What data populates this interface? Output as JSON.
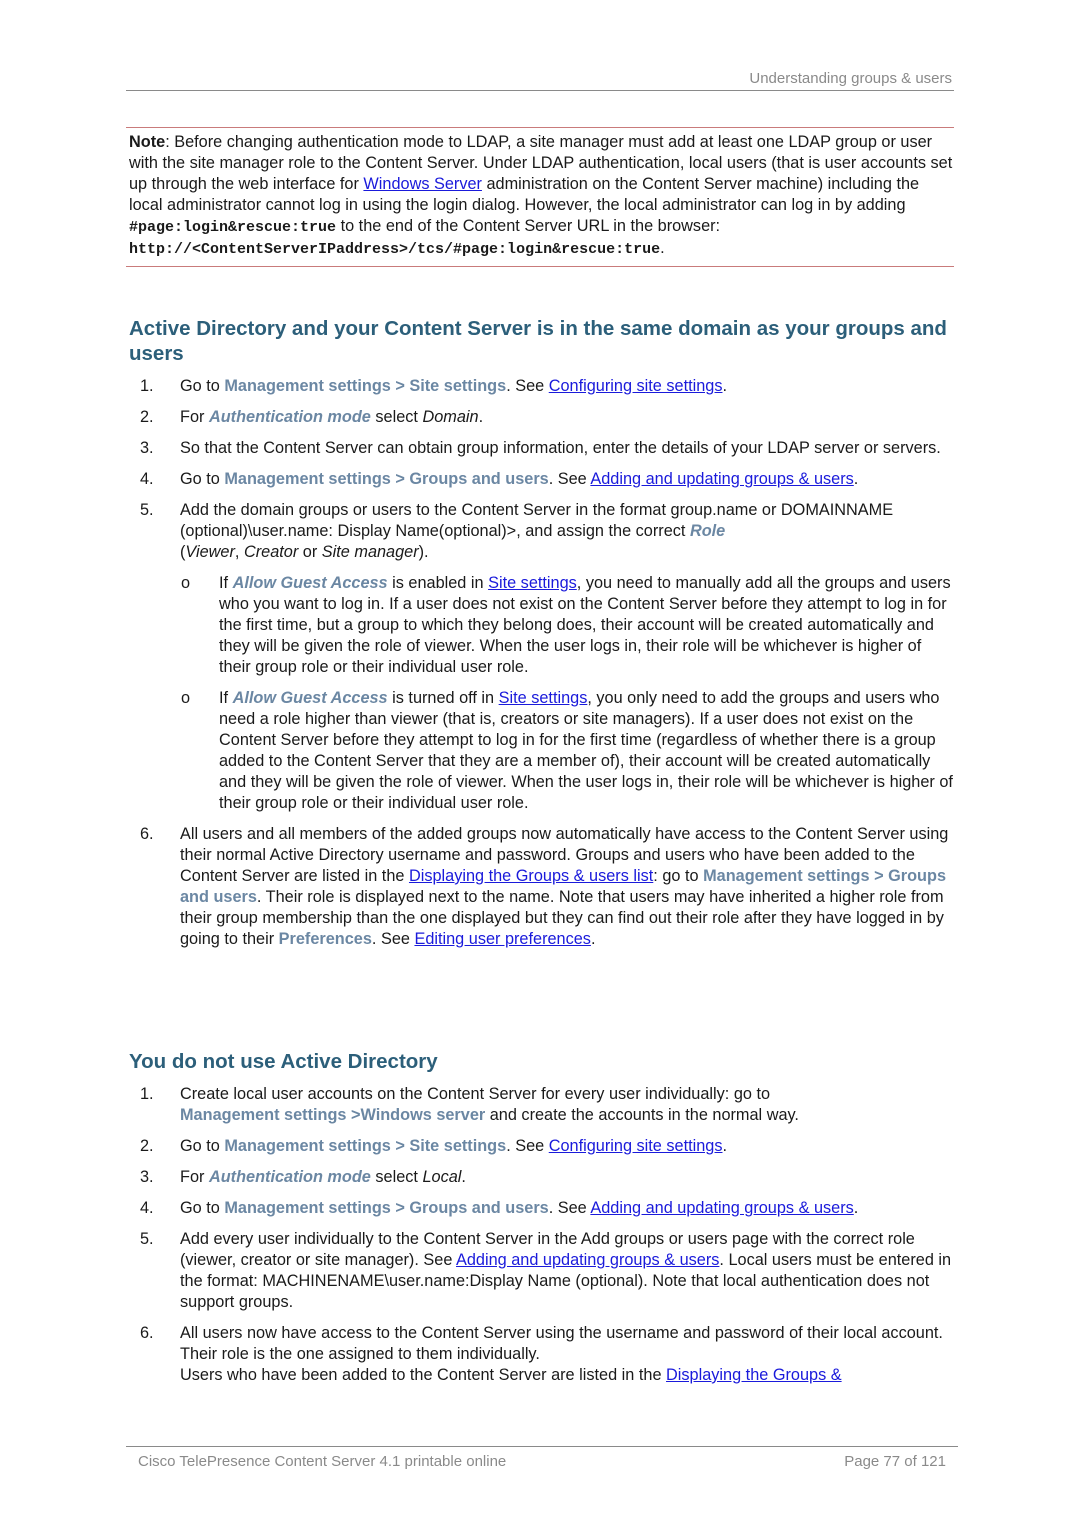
{
  "header": {
    "title": "Understanding groups & users"
  },
  "note": {
    "label": "Note",
    "text1": ": Before changing authentication mode to LDAP, a site manager must add at least one LDAP group or user with the site manager role to the Content Server. Under LDAP authentication, local users (that is user accounts set up through the web interface for ",
    "link_windows_server": "Windows Server",
    "text2": " administration on the Content Server machine) including the local administrator cannot log in using the login dialog. However, the local administrator can log in by adding ",
    "code_fragment": "#page:login&rescue:true",
    "text3": " to the end of the Content Server URL in the browser:",
    "code_url": "http://<ContentServerIPaddress>/tcs/#page:login&rescue:true",
    "text4": "."
  },
  "section1": {
    "heading": "Active Directory and your Content Server is in the same domain as your groups and users",
    "steps": [
      {
        "num": "1.",
        "t1": "Go to ",
        "ui": "Management settings > Site settings",
        "t2": ". See ",
        "link": "Configuring site settings",
        "t3": "."
      },
      {
        "num": "2.",
        "t1": "For ",
        "ui": "Authentication mode",
        "t2": " select ",
        "it": "Domain",
        "t3": "."
      },
      {
        "num": "3.",
        "text": "So that the Content Server can obtain group information, enter the details of your LDAP server or servers."
      },
      {
        "num": "4.",
        "t1": "Go to ",
        "ui": "Management settings > Groups and users",
        "t2": ". See ",
        "link": "Adding and updating groups & users",
        "t3": "."
      },
      {
        "num": "5.",
        "t1": "Add the domain groups or users to the Content Server in the format group.name or DOMAINNAME (optional)\\user.name: Display Name(optional)>, and assign the correct ",
        "ui": "Role",
        "t2": " (",
        "it1": "Viewer",
        "t3": ", ",
        "it2": "Creator",
        "t4": " or ",
        "it3": "Site manager",
        "t5": ").",
        "bullets": [
          {
            "bullet": "o",
            "t1": "If ",
            "ui": "Allow Guest Access",
            "t2": " is enabled in ",
            "link": "Site settings",
            "t3": ", you need to manually add all the groups and users who you want to log in.  If a user does not exist on the Content Server before they attempt to log in for the first time, but a group to which they belong does, their account will be created automatically and they will be given the role of viewer. When the user logs in, their role will be whichever is higher of their group role or their individual user role."
          },
          {
            "bullet": "o",
            "t1": "If ",
            "ui": "Allow Guest Access",
            "t2": " is turned off in ",
            "link": "Site settings",
            "t3": ", you only need to add the groups and users who need a role higher than viewer (that is, creators or site managers). If a user does not exist on the Content Server before they attempt to log in for the first time (regardless of whether there is a group added to the Content Server that they are a member of), their account will be created automatically and they will be given the role of viewer. When the user logs in, their role will be whichever is higher of their group role or their individual user role."
          }
        ]
      },
      {
        "num": "6.",
        "t1": "All users and all members of the added groups now automatically have access to the Content Server using their normal Active Directory username and password. Groups and users who have been added to the Content Server are listed in the ",
        "link1": "Displaying the Groups & users list",
        "t2": ": go to ",
        "ui1": "Management settings > Groups and users",
        "t3": ". Their role is displayed next to the name. Note that users may have inherited a higher role from their group membership than the one displayed but they can find out their role after they have logged in by going to their ",
        "ui2": "Preferences",
        "t4": ". See ",
        "link2": "Editing user preferences",
        "t5": "."
      }
    ]
  },
  "section2": {
    "heading": "You do not use Active Directory",
    "steps": [
      {
        "num": "1.",
        "t1": "Create local user accounts on the Content Server for every user individually: go to ",
        "ui": "Management settings >Windows server",
        "t2": " and create the accounts in the normal way."
      },
      {
        "num": "2.",
        "t1": "Go to ",
        "ui": "Management settings > Site settings",
        "t2": ". See ",
        "link": "Configuring site settings",
        "t3": "."
      },
      {
        "num": "3.",
        "t1": "For ",
        "ui": "Authentication mode",
        "t2": " select ",
        "it": "Local",
        "t3": "."
      },
      {
        "num": "4.",
        "t1": "Go to ",
        "ui": "Management settings > Groups and users",
        "t2": ". See ",
        "link": "Adding and updating groups & users",
        "t3": "."
      },
      {
        "num": "5.",
        "t1": "Add every user individually to the Content Server in the Add groups or users page with the correct role (viewer, creator or site manager). See ",
        "link": "Adding and updating groups & users",
        "t2": ". Local users must be entered in the format: MACHINENAME\\user.name:Display Name (optional). Note that local authentication does not support groups."
      },
      {
        "num": "6.",
        "t1": "All users now have access to the Content Server using the username and password of their local account. Their role is the one assigned to them individually.",
        "t2": "Users who have been added to the Content Server are listed in the ",
        "link": "Displaying the Groups &"
      }
    ]
  },
  "footer": {
    "left": "Cisco TelePresence Content Server 4.1 printable online",
    "right": "Page 77 of 121"
  }
}
